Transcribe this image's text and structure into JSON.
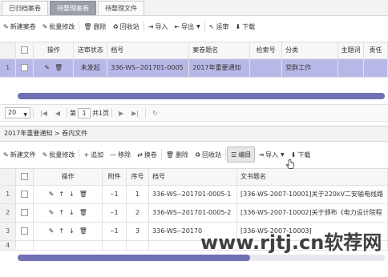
{
  "tabs": [
    {
      "label": "已归档案卷",
      "active": false
    },
    {
      "label": "待整理案卷",
      "active": true
    },
    {
      "label": "待整理文件",
      "active": false
    }
  ],
  "toolbar1": [
    {
      "icon": "✎",
      "label": "新建案卷"
    },
    {
      "icon": "✎",
      "label": "批量修改"
    },
    {
      "icon": "🗑",
      "label": "删除"
    },
    {
      "icon": "♻",
      "label": "回收站"
    },
    {
      "icon": "⇥",
      "label": "导入"
    },
    {
      "icon": "⇤",
      "label": "导出",
      "dropdown": true
    },
    {
      "icon": "↖",
      "label": "运审"
    },
    {
      "icon": "⬇",
      "label": "下载"
    }
  ],
  "grid1": {
    "headers": [
      "",
      "",
      "操作",
      "送审状态",
      "档号",
      "案卷题名",
      "检索号",
      "分类",
      "主题词",
      "责任"
    ],
    "rows": [
      {
        "num": "1",
        "status": "未发起",
        "code": "336-WS--201701-0005",
        "title": "2017年重要通知",
        "search": "",
        "category": "党群工作",
        "keyword": "",
        "resp": ""
      }
    ]
  },
  "pager1": {
    "page_size": "20",
    "page_label": "第",
    "page": "1",
    "total": "共1页"
  },
  "breadcrumb": "2017年重要通知 > 卷内文件",
  "toolbar2": [
    {
      "icon": "✎",
      "label": "新建文件"
    },
    {
      "icon": "✎",
      "label": "批量修改"
    },
    {
      "icon": "+",
      "label": "追加"
    },
    {
      "icon": "—",
      "label": "移除"
    },
    {
      "icon": "⇄",
      "label": "换卷"
    },
    {
      "icon": "🗑",
      "label": "删除"
    },
    {
      "icon": "♻",
      "label": "回收站"
    },
    {
      "icon": "☰",
      "label": "编目",
      "pressed": true
    },
    {
      "icon": "⇥",
      "label": "导入",
      "dropdown": true
    },
    {
      "icon": "⬇",
      "label": "下载"
    }
  ],
  "grid2": {
    "headers": [
      "",
      "",
      "操作",
      "附件",
      "序号",
      "档号",
      "文书题名"
    ],
    "rows": [
      {
        "num": "1",
        "attach": "1",
        "seq": "1",
        "code": "336-WS--201701-0005-1",
        "title": "[336-WS-2007-10001]关于220kV二安输电线路"
      },
      {
        "num": "2",
        "attach": "1",
        "seq": "2",
        "code": "336-WS--201701-0005-2",
        "title": "[336-WS-2007-10002]关于颁布《电力设计院程"
      },
      {
        "num": "3",
        "attach": "1",
        "seq": "3",
        "code": "336-WS--20170",
        "title": "[336-WS-2007-10003]"
      }
    ]
  },
  "row4_num": "4",
  "watermark": "www.rjtj.cn软荐网"
}
